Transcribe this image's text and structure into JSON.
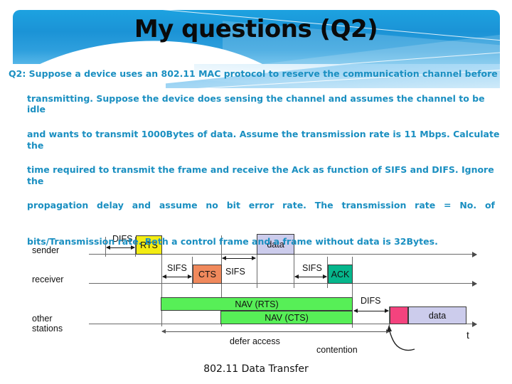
{
  "slide": {
    "title": "My questions (Q2)",
    "banner_color": "#1b93d6",
    "text_color": "#1a8fc1"
  },
  "body": {
    "line1": "Q2: Suppose a device uses an 802.11 MAC protocol to reserve  the communication channel before",
    "line2": "transmitting. Suppose the device does sensing the channel and assumes the channel to be idle",
    "line3": "and wants to transmit 1000Bytes of data. Assume the transmission rate is 11 Mbps. Calculate the",
    "line4": "time required to transmit the frame and receive the Ack as function of SIFS and DIFS. Ignore the",
    "line5": "propagation delay and assume no bit error rate. The transmission rate = No. of",
    "line6": "bits/Transmission rate. Both a control frame and a frame without data is 32Bytes."
  },
  "diagram": {
    "caption": "802.11 Data Transfer",
    "row_labels": {
      "sender": "sender",
      "receiver": "receiver",
      "other_stations": "other\nstations"
    },
    "time_axis_label": "t",
    "frames": [
      {
        "label": "RTS",
        "row": "sender",
        "color": "#f3ec13"
      },
      {
        "label": "data",
        "row": "sender",
        "color": "#ccccec"
      },
      {
        "label": "CTS",
        "row": "receiver",
        "color": "#f0895c"
      },
      {
        "label": "ACK",
        "row": "receiver",
        "color": "#06b68c"
      },
      {
        "label": "NAV (RTS)",
        "row": "other",
        "color": "#57ef57"
      },
      {
        "label": "NAV (CTS)",
        "row": "other",
        "color": "#57ef57"
      },
      {
        "label": "contention",
        "row": "other",
        "color": "#f4437e"
      },
      {
        "label": "data",
        "row": "other",
        "color": "#ccccec"
      }
    ],
    "intervals": {
      "difs_sender": "DIFS",
      "sifs_1": "SIFS",
      "sifs_2": "SIFS",
      "sifs_3": "SIFS",
      "difs_other": "DIFS",
      "defer_access": "defer access",
      "contention": "contention"
    }
  }
}
